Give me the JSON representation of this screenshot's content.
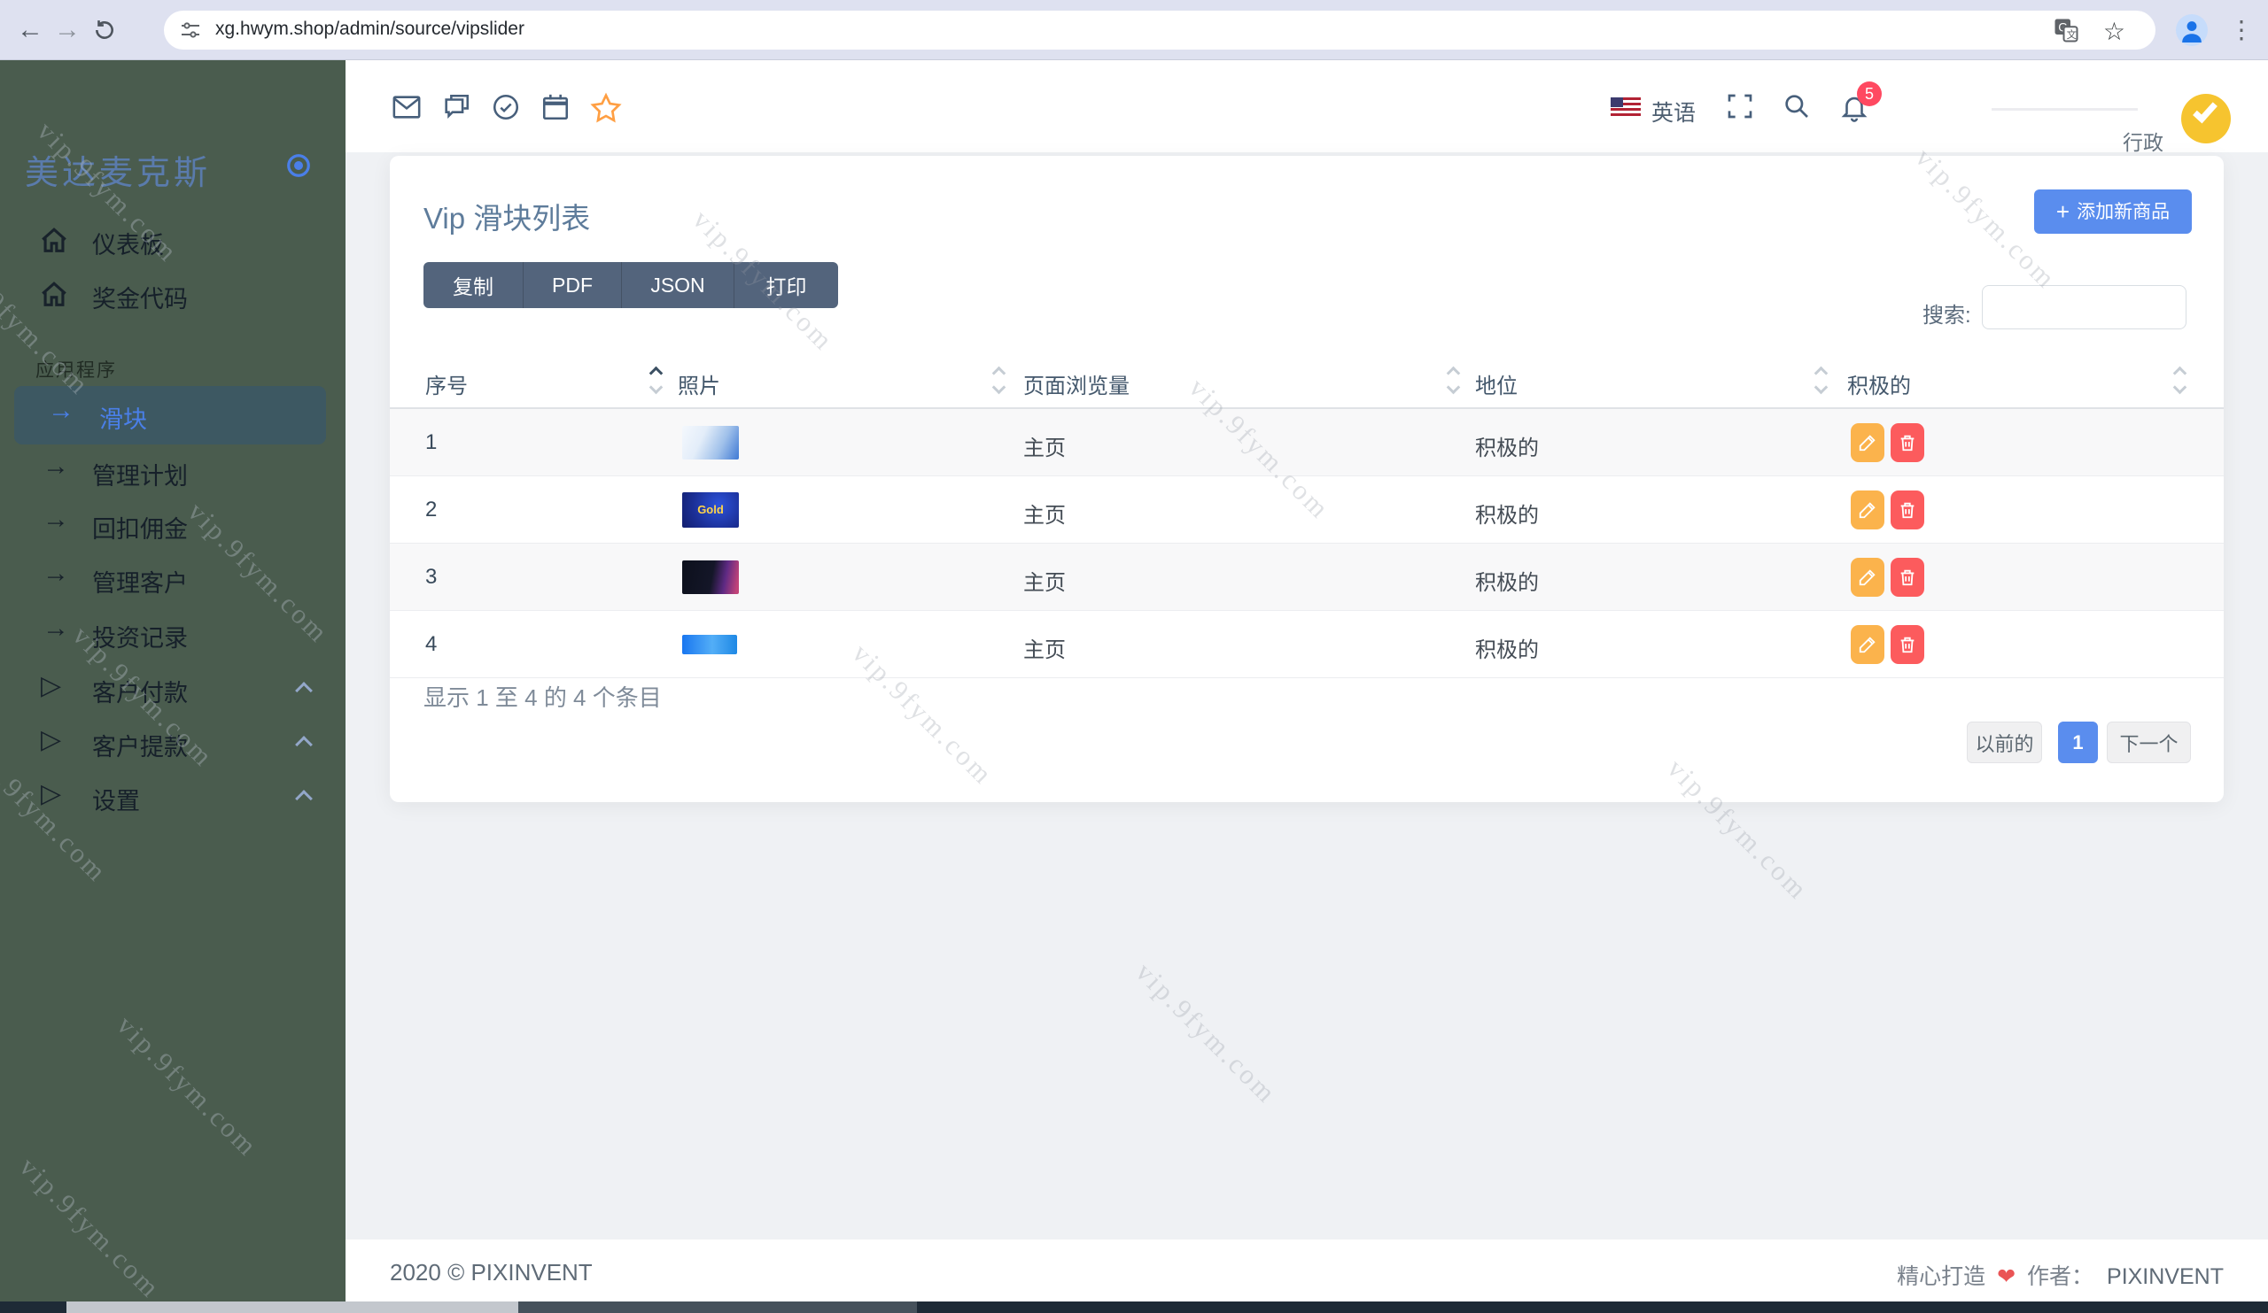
{
  "browser": {
    "url": "xg.hwym.shop/admin/source/vipslider"
  },
  "watermark": {
    "text": "vip.9fym.com"
  },
  "sidebar": {
    "logo": "美达麦克斯",
    "items": [
      {
        "label": "仪表板"
      },
      {
        "label": "奖金代码"
      }
    ],
    "section": "应用程序",
    "app_items": [
      {
        "label": "滑块"
      },
      {
        "label": "管理计划"
      },
      {
        "label": "回扣佣金"
      },
      {
        "label": "管理客户"
      },
      {
        "label": "投资记录"
      },
      {
        "label": "客户付款"
      },
      {
        "label": "客户提款"
      },
      {
        "label": "设置"
      }
    ]
  },
  "topbar": {
    "language": "英语",
    "badge": "5",
    "role": "行政"
  },
  "page": {
    "title": "Vip 滑块列表",
    "export_buttons": [
      {
        "label": "复制"
      },
      {
        "label": "PDF"
      },
      {
        "label": "JSON"
      },
      {
        "label": "打印"
      }
    ],
    "add_button": "添加新商品",
    "add_plus": "+",
    "search_label": "搜索:"
  },
  "table": {
    "columns": [
      {
        "label": "序号"
      },
      {
        "label": "照片"
      },
      {
        "label": "页面浏览量"
      },
      {
        "label": "地位"
      },
      {
        "label": "积极的"
      }
    ],
    "rows": [
      {
        "no": "1",
        "photo": "light blue promo banner with blue swirl",
        "photo_text": "",
        "views": "主页",
        "status": "积极的"
      },
      {
        "no": "2",
        "photo": "royal blue banner with yellow Earn Gold Coins text",
        "photo_text": "Gold",
        "views": "主页",
        "status": "积极的"
      },
      {
        "no": "3",
        "photo": "dark banner with purple portrait",
        "photo_text": "",
        "views": "主页",
        "status": "积极的"
      },
      {
        "no": "4",
        "photo": "bright blue wide banner with figure",
        "photo_text": "",
        "views": "主页",
        "status": "积极的"
      }
    ],
    "info": "显示 1 至 4 的 4 个条目",
    "pagination": {
      "prev": "以前的",
      "page": "1",
      "next": "下一个"
    }
  },
  "footer": {
    "left": "2020 © PIXINVENT",
    "made": "精心打造",
    "heart": "❤",
    "author_label": "作者：",
    "author": "PIXINVENT"
  },
  "colors": {
    "accent_blue": "#5a8dee",
    "edit_orange": "#fbb34c",
    "delete_red": "#fc5b5d",
    "sidebar_green": "#4a5c4e",
    "badge_red": "#ff4961",
    "button_slate": "#53647c"
  }
}
